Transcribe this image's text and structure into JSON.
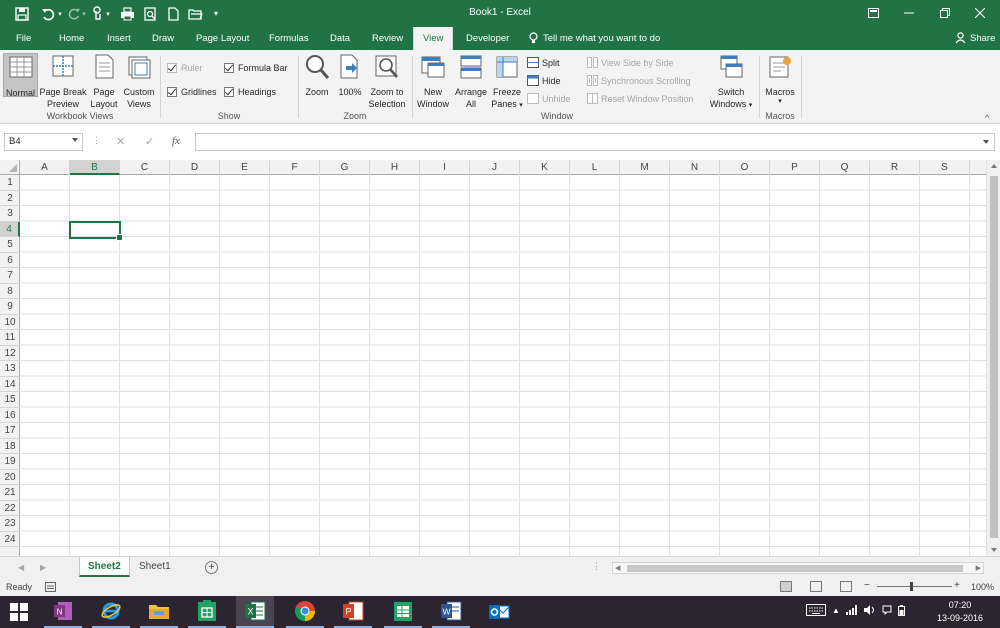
{
  "window": {
    "title": "Book1 - Excel"
  },
  "tabs": [
    "File",
    "Home",
    "Insert",
    "Draw",
    "Page Layout",
    "Formulas",
    "Data",
    "Review",
    "View",
    "Developer"
  ],
  "active_tab": "View",
  "tellme": "Tell me what you want to do",
  "share": "Share",
  "ribbon": {
    "workbook_views": {
      "label": "Workbook Views",
      "normal": "Normal",
      "page_break_1": "Page Break",
      "page_break_2": "Preview",
      "page_layout_1": "Page",
      "page_layout_2": "Layout",
      "custom_views_1": "Custom",
      "custom_views_2": "Views"
    },
    "show": {
      "label": "Show",
      "ruler": "Ruler",
      "ruler_checked": true,
      "ruler_disabled": true,
      "formula_bar": "Formula Bar",
      "formula_bar_checked": true,
      "gridlines": "Gridlines",
      "gridlines_checked": true,
      "headings": "Headings",
      "headings_checked": true
    },
    "zoom": {
      "label": "Zoom",
      "zoom": "Zoom",
      "hundred": "100%",
      "zoom_sel_1": "Zoom to",
      "zoom_sel_2": "Selection"
    },
    "window": {
      "label": "Window",
      "new_window_1": "New",
      "new_window_2": "Window",
      "arrange_1": "Arrange",
      "arrange_2": "All",
      "freeze_1": "Freeze",
      "freeze_2": "Panes",
      "split": "Split",
      "hide": "Hide",
      "unhide": "Unhide",
      "side_by_side": "View Side by Side",
      "sync_scroll": "Synchronous Scrolling",
      "reset_pos": "Reset Window Position",
      "switch_1": "Switch",
      "switch_2": "Windows"
    },
    "macros": {
      "label": "Macros",
      "macros": "Macros"
    }
  },
  "formula_bar": {
    "name_box": "B4",
    "fx": "fx",
    "value": ""
  },
  "grid": {
    "columns": [
      "A",
      "B",
      "C",
      "D",
      "E",
      "F",
      "G",
      "H",
      "I",
      "J",
      "K",
      "L",
      "M",
      "N",
      "O",
      "P",
      "Q",
      "R",
      "S"
    ],
    "rows": [
      "1",
      "2",
      "3",
      "4",
      "5",
      "6",
      "7",
      "8",
      "9",
      "10",
      "11",
      "12",
      "13",
      "14",
      "15",
      "16",
      "17",
      "18",
      "19",
      "20",
      "21",
      "22",
      "23",
      "24"
    ],
    "selected_col": "B",
    "selected_row": "4"
  },
  "sheets": [
    "Sheet2",
    "Sheet1"
  ],
  "active_sheet": "Sheet2",
  "status": {
    "ready": "Ready",
    "zoom": "100%"
  },
  "taskbar": {
    "apps": [
      "windows-start",
      "onenote",
      "internet-explorer",
      "file-explorer",
      "sheets-app",
      "excel",
      "chrome",
      "powerpoint",
      "sheets-app-2",
      "word",
      "outlook"
    ],
    "time": "07:20",
    "date": "13-09-2016"
  },
  "colors": {
    "excel_green": "#217346",
    "taskbar": "#2b2532"
  }
}
